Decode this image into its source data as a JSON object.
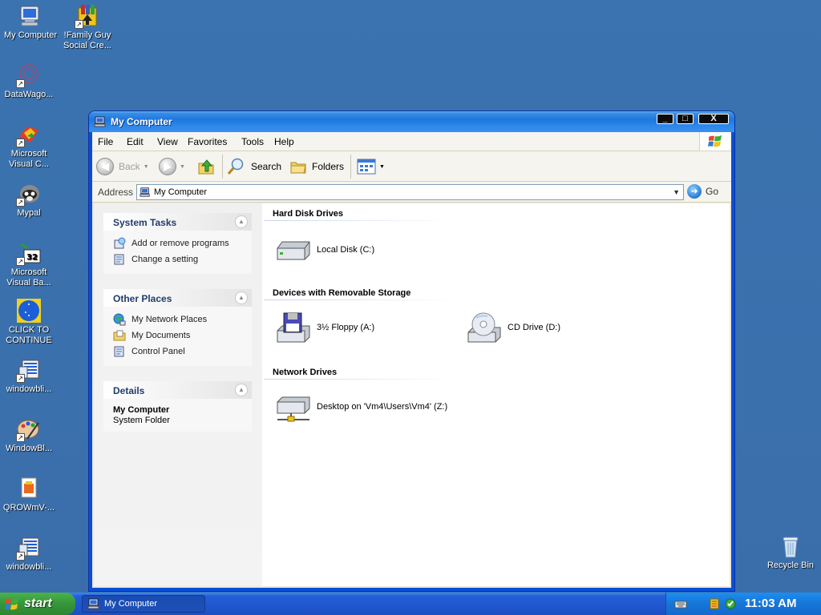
{
  "desktop": {
    "icons": [
      {
        "label": "My Computer"
      },
      {
        "label": "!Family Guy Social Cre..."
      },
      {
        "label": "DataWago..."
      },
      {
        "label": "Microsoft Visual C..."
      },
      {
        "label": "Mypal"
      },
      {
        "label": "Microsoft Visual Ba..."
      },
      {
        "label": "CLICK TO CONTINUE"
      },
      {
        "label": "windowbli..."
      },
      {
        "label": "WindowBl..."
      },
      {
        "label": "QROWmV-..."
      },
      {
        "label": "windowbli..."
      },
      {
        "label": "Recycle Bin"
      }
    ]
  },
  "window": {
    "title": "My Computer",
    "controls": {
      "minimize": "_",
      "maximize": "□",
      "close": "X"
    },
    "menu": [
      "File",
      "Edit",
      "View",
      "Favorites",
      "Tools",
      "Help"
    ],
    "toolbar": {
      "back": "Back",
      "search": "Search",
      "folders": "Folders"
    },
    "address": {
      "label": "Address",
      "value": "My Computer",
      "go": "Go"
    },
    "taskpane": {
      "system_tasks": {
        "title": "System Tasks",
        "items": [
          "Add or remove programs",
          "Change a setting"
        ]
      },
      "other_places": {
        "title": "Other Places",
        "items": [
          "My Network Places",
          "My Documents",
          "Control Panel"
        ]
      },
      "details": {
        "title": "Details",
        "name": "My Computer",
        "type": "System Folder"
      }
    },
    "groups": {
      "hard_disk": {
        "title": "Hard Disk Drives",
        "items": [
          "Local Disk (C:)"
        ]
      },
      "removable": {
        "title": "Devices with Removable Storage",
        "items": [
          "3½ Floppy (A:)",
          "CD Drive (D:)"
        ]
      },
      "network": {
        "title": "Network Drives",
        "items": [
          "Desktop on 'Vm4\\Users\\Vm4' (Z:)"
        ]
      }
    }
  },
  "taskbar": {
    "start": "start",
    "task": "My Computer",
    "clock": "11:03 AM"
  },
  "colors": {
    "desktop": "#3a6ea5",
    "titlebar": "#1f77dd",
    "start": "#35963a",
    "taskbar": "#2056d0"
  }
}
